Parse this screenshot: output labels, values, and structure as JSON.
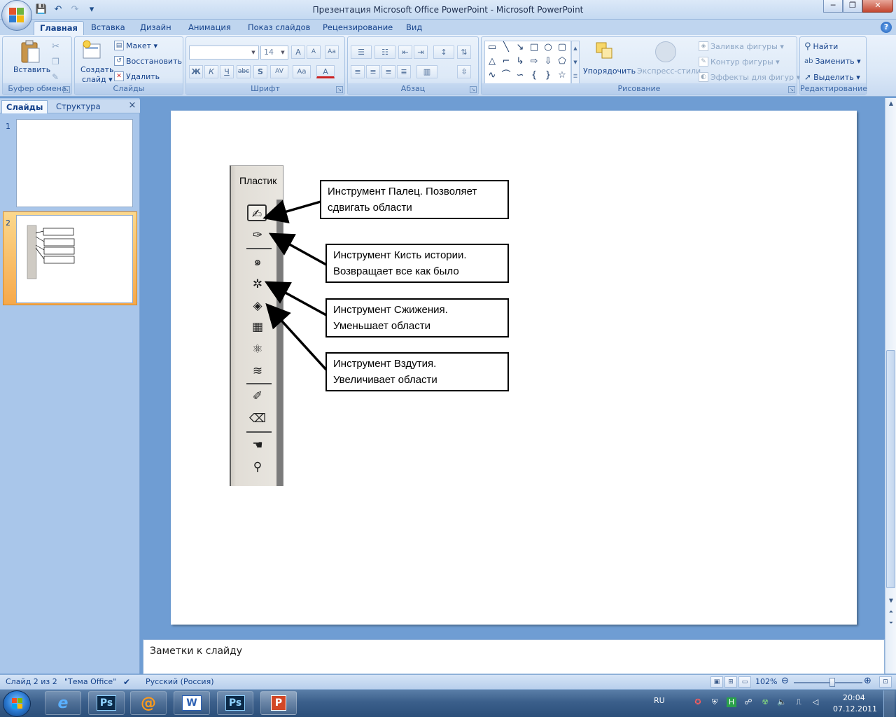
{
  "window": {
    "title": "Презентация Microsoft Office PowerPoint - Microsoft PowerPoint"
  },
  "qat": {
    "save_icon": "💾",
    "undo_icon": "↶",
    "redo_icon": "↷",
    "customize_icon": "▾"
  },
  "caption": {
    "minimize": "─",
    "maximize": "❐",
    "close": "✕"
  },
  "tabs": [
    "Главная",
    "Вставка",
    "Дизайн",
    "Анимация",
    "Показ слайдов",
    "Рецензирование",
    "Вид"
  ],
  "help": "?",
  "ribbon": {
    "clipboard": {
      "label": "Буфер обмена",
      "paste": "Вставить"
    },
    "slides": {
      "label": "Слайды",
      "new_slide_1": "Создать",
      "new_slide_2": "слайд ▾",
      "layout": "Макет ▾",
      "reset": "Восстановить",
      "delete": "Удалить"
    },
    "font": {
      "label": "Шрифт",
      "font_name": "",
      "font_size": "14",
      "grow": "A",
      "shrink": "A",
      "clear": "Aa",
      "bold": "Ж",
      "italic": "К",
      "underline": "Ч",
      "strike": "abc",
      "shadow": "S",
      "spacing": "AV",
      "case": "Aa",
      "color": "A"
    },
    "paragraph": {
      "label": "Абзац"
    },
    "drawing": {
      "label": "Рисование",
      "arrange": "Упорядочить",
      "quick_styles": "Экспресс-стили",
      "fill": "Заливка фигуры ▾",
      "outline": "Контур фигуры ▾",
      "effects": "Эффекты для фигур ▾"
    },
    "editing": {
      "label": "Редактирование",
      "find": "Найти",
      "replace": "Заменить ▾",
      "select": "Выделить ▾"
    }
  },
  "left_pane": {
    "tab_slides": "Слайды",
    "tab_outline": "Структура",
    "close": "×",
    "slides": [
      {
        "num": "1"
      },
      {
        "num": "2"
      }
    ]
  },
  "slide": {
    "toolbox_title": "Пластик",
    "callouts": [
      {
        "line1": "Инструмент Палец. Позволяет",
        "line2": "сдвигать области"
      },
      {
        "line1": "Инструмент Кисть истории.",
        "line2": "Возвращает все как было"
      },
      {
        "line1": "Инструмент Сжижения.",
        "line2": "Уменьшает области"
      },
      {
        "line1": "Инструмент Вздутия.",
        "line2": "Увеличивает области"
      }
    ]
  },
  "notes": {
    "placeholder": "Заметки к слайду"
  },
  "status": {
    "slide": "Слайд 2 из 2",
    "theme": "\"Тема Office\"",
    "language": "Русский (Россия)",
    "zoom": "102%",
    "zoom_fraction": 0.56
  },
  "taskbar": {
    "lang": "RU",
    "time": "20:04",
    "date": "07.12.2011",
    "apps": [
      {
        "name": "Internet Explorer",
        "glyph": "e"
      },
      {
        "name": "Photoshop",
        "glyph": "Ps"
      },
      {
        "name": "Mail.Ru Agent",
        "glyph": "@"
      },
      {
        "name": "Word",
        "glyph": "W"
      },
      {
        "name": "Photoshop",
        "glyph": "Ps"
      },
      {
        "name": "PowerPoint",
        "glyph": "P"
      }
    ]
  },
  "colors": {
    "accent": "#15428b",
    "ribbon_bg": "#dbe8f7",
    "selected_thumb": "#f6a84a"
  }
}
